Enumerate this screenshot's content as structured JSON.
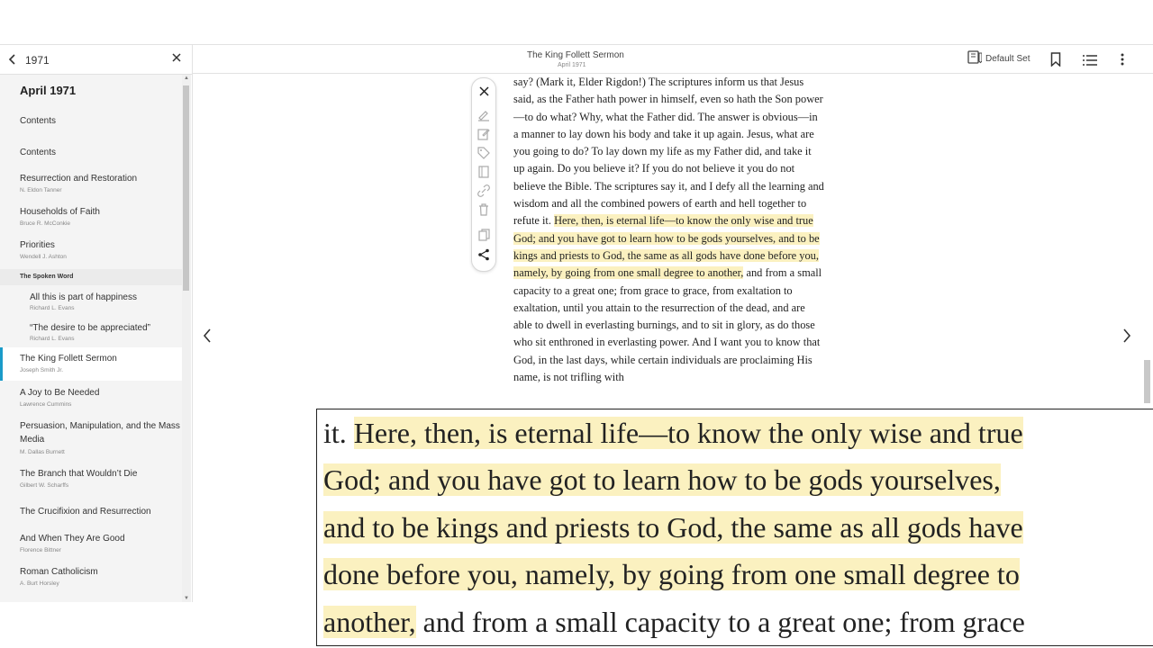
{
  "sidebar": {
    "year": "1971",
    "title": "April 1971",
    "section_label": "The Spoken Word",
    "items": [
      {
        "title": "Contents",
        "author": ""
      },
      {
        "title": "Contents",
        "author": ""
      },
      {
        "title": "Resurrection and Restoration",
        "author": "N. Eldon Tanner"
      },
      {
        "title": "Households of Faith",
        "author": "Bruce R. McConkie"
      },
      {
        "title": "Priorities",
        "author": "Wendell J. Ashton"
      },
      {
        "title": "All this is part of happiness",
        "author": "Richard L. Evans"
      },
      {
        "title": "“The desire to be appreciated”",
        "author": "Richard L. Evans"
      },
      {
        "title": "The King Follett Sermon",
        "author": "Joseph Smith Jr."
      },
      {
        "title": "A Joy to Be Needed",
        "author": "Lawrence Cummins"
      },
      {
        "title": "Persuasion, Manipulation, and the Mass",
        "title2": "Media",
        "author": "M. Dallas Burnett"
      },
      {
        "title": "The Branch that Wouldn’t Die",
        "author": "Gilbert W. Scharffs"
      },
      {
        "title": "The Crucifixion and Resurrection",
        "author": ""
      },
      {
        "title": "And When They Are Good",
        "author": "Florence Bittner"
      },
      {
        "title": "Roman Catholicism",
        "author": "A. Burt Horsley"
      }
    ]
  },
  "header": {
    "title": "The King Follett Sermon",
    "subtitle": "April 1971",
    "default_set_label": "Default Set"
  },
  "article": {
    "plain_before": "say? (Mark it, Elder Rigdon!) The scriptures inform us that Jesus said, as the Father hath power in himself, even so hath the Son power—to do what? Why, what the Father did. The answer is obvious—in a manner to lay down his body and take it up again. Jesus, what are you going to do? To lay down my life as my Father did, and take it up again. Do you believe it? If you do not believe it you do not believe the Bible. The scriptures say it, and I defy all the learning and wisdom and all the combined powers of earth and hell together to refute it. ",
    "highlighted": "Here, then, is eternal life—to know the only wise and true God; and you have got to learn how to be gods yourselves, and to be kings and priests to God, the same as all gods have done before you, namely, by going from one small degree to another,",
    "plain_after": " and from a small capacity to a great one; from grace to grace, from exaltation to exaltation, until you attain to the resurrection of the dead, and are able to dwell in everlasting burnings, and to sit in glory, as do those who sit enthroned in everlasting power. And I want you to know that God, in the last days, while certain individuals are proclaiming His name, is not trifling with"
  },
  "zoom": {
    "lines": [
      {
        "pre": "it. ",
        "hl": "Here, then, is eternal life—to know the only wise and true",
        "post": ""
      },
      {
        "pre": "",
        "hl": "God; and you have got to learn how to be gods yourselves,",
        "post": ""
      },
      {
        "pre": "",
        "hl": "and to be kings and priests to God, the same as all gods have",
        "post": ""
      },
      {
        "pre": "",
        "hl": "done before you, namely, by going from one small degree to",
        "post": ""
      },
      {
        "pre": "",
        "hl": "another,",
        "post": " and from a small capacity to a great one; from grace"
      }
    ]
  },
  "colors": {
    "highlight": "#fbf1c0",
    "active_accent": "#1a9bc9",
    "sidebar_bg": "#f4f4f4"
  }
}
